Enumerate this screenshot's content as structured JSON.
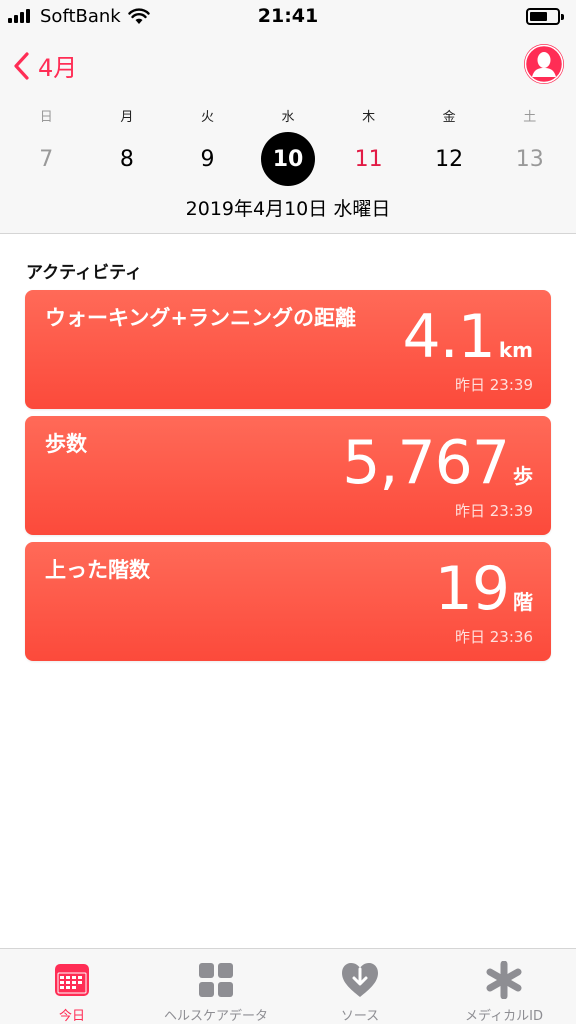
{
  "status_bar": {
    "carrier": "SoftBank",
    "time": "21:41"
  },
  "header": {
    "back_label": "4月",
    "weekdays": [
      "日",
      "月",
      "火",
      "水",
      "木",
      "金",
      "土"
    ],
    "dates": [
      "7",
      "8",
      "9",
      "10",
      "11",
      "12",
      "13"
    ],
    "selected_index": 3,
    "full_date": "2019年4月10日 水曜日"
  },
  "section": {
    "title": "アクティビティ"
  },
  "cards": [
    {
      "title": "ウォーキング+ランニングの距離",
      "value": "4.1",
      "unit": "km",
      "time": "昨日 23:39"
    },
    {
      "title": "歩数",
      "value": "5,767",
      "unit": "歩",
      "time": "昨日 23:39"
    },
    {
      "title": "上った階数",
      "value": "19",
      "unit": "階",
      "time": "昨日 23:36"
    }
  ],
  "tabs": [
    {
      "label": "今日",
      "icon": "calendar-icon"
    },
    {
      "label": "ヘルスケアデータ",
      "icon": "grid-icon"
    },
    {
      "label": "ソース",
      "icon": "heart-download-icon"
    },
    {
      "label": "メディカルID",
      "icon": "asterisk-icon"
    }
  ],
  "colors": {
    "accent": "#ff2d55",
    "card": "#fc4a3b",
    "today_date": "#e21b45"
  }
}
